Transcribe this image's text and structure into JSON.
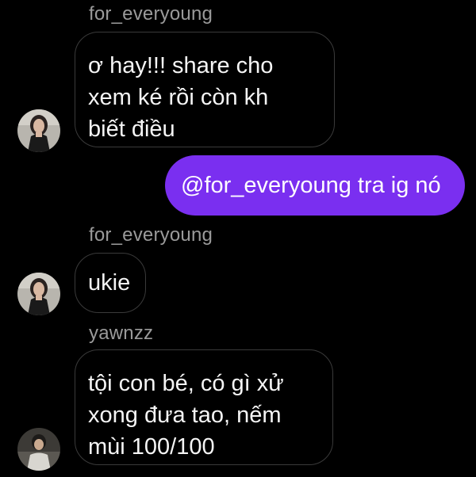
{
  "messages": [
    {
      "sender": "for_everyoung",
      "text": "ơ hay!!! share cho\nxem ké rồi còn kh\nbiết điều",
      "avatar": "girl-avatar"
    },
    {
      "sender": "",
      "text": "@for_everyoung tra ig nó",
      "outgoing": true
    },
    {
      "sender": "for_everyoung",
      "text": "ukie",
      "avatar": "girl-avatar"
    },
    {
      "sender": "yawnzz",
      "text": "tội con bé, có gì xử\nxong đưa tao, nếm\nmùi 100/100",
      "avatar": "guy-avatar"
    }
  ],
  "colors": {
    "background": "#000000",
    "outgoing_bubble": "#7a2ff0",
    "incoming_border": "#3a3a3a",
    "sender_text": "#9a9a9a"
  }
}
